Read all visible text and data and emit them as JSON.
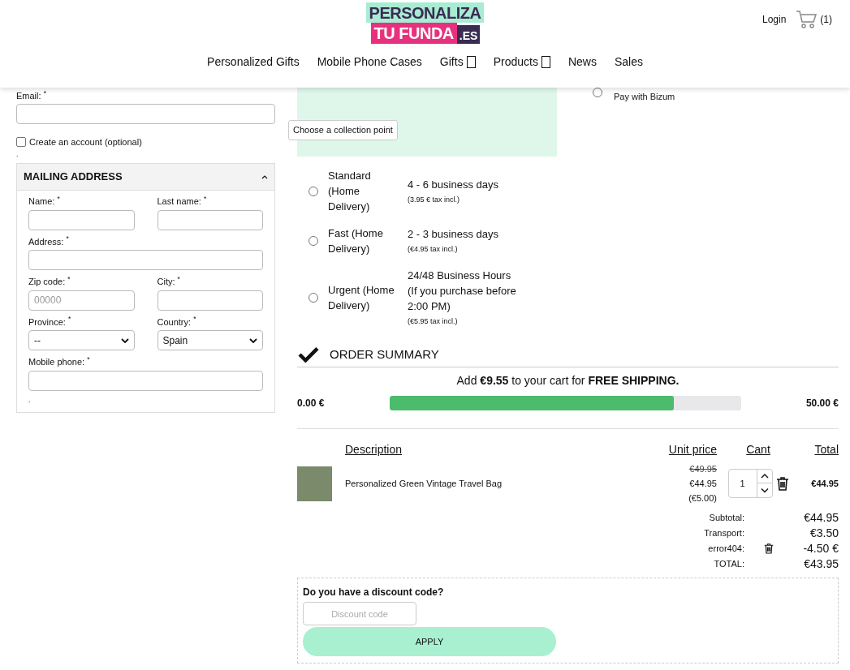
{
  "header": {
    "logo": {
      "line_1": "PERSONALIZA",
      "line_2": "TU FUNDA",
      "suffix": ".ES"
    },
    "login": "Login",
    "cart_count": "(1)",
    "nav": [
      {
        "label": "Personalized Gifts",
        "has_menu": false
      },
      {
        "label": "Mobile Phone Cases",
        "has_menu": false
      },
      {
        "label": "Gifts",
        "has_menu": true
      },
      {
        "label": "Products",
        "has_menu": true
      },
      {
        "label": "News",
        "has_menu": false
      },
      {
        "label": "Sales",
        "has_menu": false
      }
    ]
  },
  "account": {
    "email_label": "Email: $^{*}$",
    "create_account": {
      "label": "Create an account (optional)",
      "checked": false
    },
    "footnote": "."
  },
  "mailing_address": {
    "title": "MAILING ADDRESS",
    "expanded": true,
    "footnote": ".",
    "rows": [
      [
        {
          "label": "Name: $^{*}$",
          "kind": "text"
        },
        {
          "label": "Last name: $^{*}$",
          "kind": "text"
        }
      ],
      [
        {
          "label": "Address: $^{*}$",
          "kind": "text"
        }
      ],
      [
        {
          "label": "Zip code: $^{*}$",
          "kind": "text",
          "placeholder": "00000"
        },
        {
          "label": "City: $^{*}$",
          "kind": "text"
        }
      ],
      [
        {
          "label": "Province: $^{*}$",
          "kind": "select",
          "value": "--"
        },
        {
          "label": "Country: $^{*}$",
          "kind": "select",
          "value": "Spain"
        }
      ],
      [
        {
          "label": "Mobile phone: $^{*}$",
          "kind": "text"
        }
      ]
    ]
  },
  "collection_point_button": "Choose a collection point",
  "payment_options": [
    {
      "label": "Pay with Bizum",
      "selected": false
    }
  ],
  "shipping_options": [
    {
      "name": "Standard (Home Delivery)",
      "time": "4 - 6 business days",
      "price": "(3.95 € tax incl.)",
      "selected": false
    },
    {
      "name": "Fast (Home Delivery)",
      "time": "2 - 3 business days",
      "price": "(€4.95 tax incl.)",
      "selected": false
    },
    {
      "name": "Urgent (Home Delivery)",
      "time": "24/48 Business Hours (If you purchase before 2:00 PM)",
      "price": "(€5.95 tax incl.)",
      "selected": false
    }
  ],
  "order_summary": {
    "title": "ORDER SUMMARY",
    "free_shipping": {
      "message": "Add **€9.55** to your cart for **FREE SHIPPING.**",
      "min": "0.00 €",
      "max": "50.00 €",
      "level": 0.81
    },
    "columns": [
      "Description",
      "Unit price",
      "Cant",
      "Total"
    ],
    "items": [
      {
        "name": "Personalized Green Vintage Travel Bag",
        "original_price": "€49.95",
        "price": "€44.95",
        "discount": "(€5.00)",
        "quantity": "1",
        "total": "€44.95"
      }
    ],
    "totals": [
      {
        "label": "Subtotal:",
        "value": "€44.95",
        "removable": false
      },
      {
        "label": "Transport:",
        "value": "€3.50",
        "removable": false
      },
      {
        "label": "error404:",
        "value": "-4.50 €",
        "removable": true
      },
      {
        "label": "TOTAL:",
        "value": "€43.95",
        "removable": false
      }
    ]
  },
  "discount": {
    "question": "Do you have a discount code?",
    "placeholder": "Discount code",
    "button": "APPLY"
  }
}
